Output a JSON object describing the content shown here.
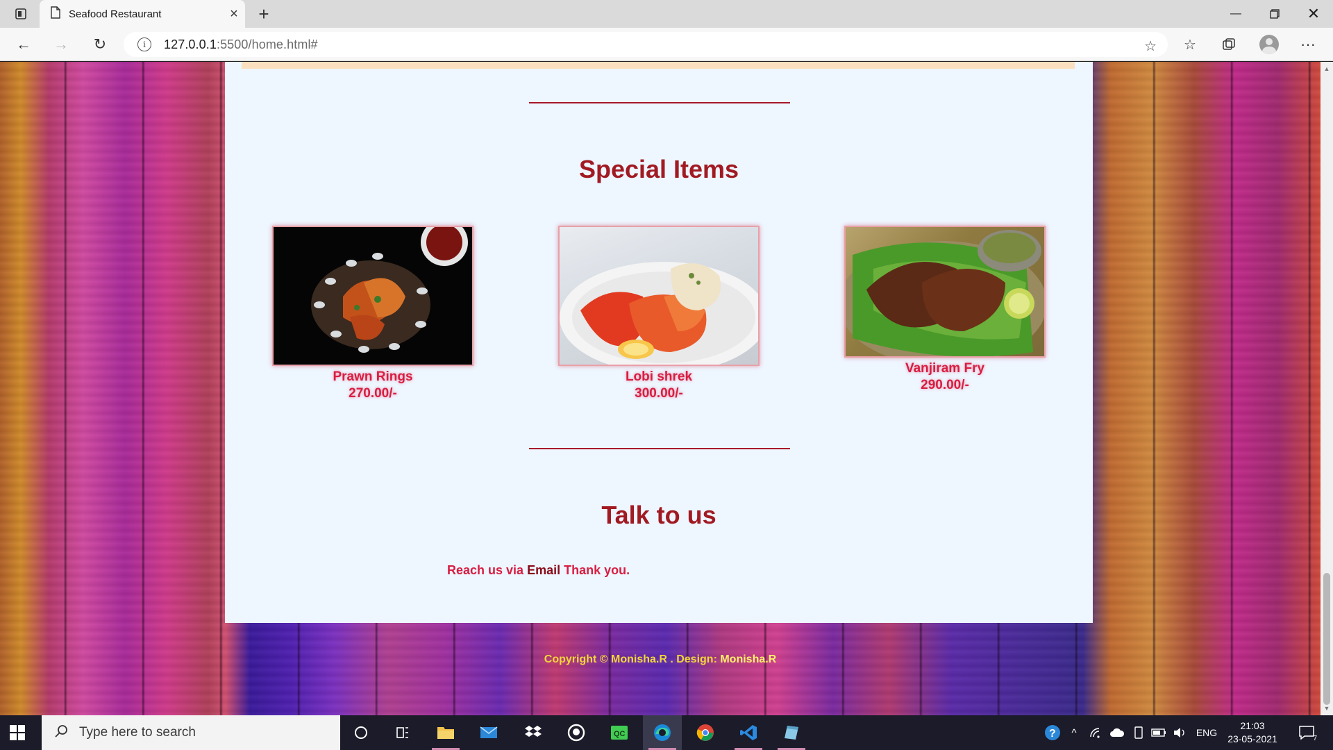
{
  "browser": {
    "tab_title": "Seafood Restaurant",
    "url_host": "127.0.0.1",
    "url_path": ":5500/home.html#"
  },
  "page": {
    "special_title": "Special Items",
    "items": [
      {
        "name": "Prawn Rings",
        "price": "270.00/-"
      },
      {
        "name": "Lobi shrek",
        "price": "300.00/-"
      },
      {
        "name": "Vanjiram Fry",
        "price": "290.00/-"
      }
    ],
    "contact_title": "Talk to us",
    "reach_prefix": "Reach us via",
    "reach_link": "Email",
    "reach_suffix": "Thank you.",
    "footer_prefix": "Copyright © Monisha.R . Design:",
    "footer_name": "Monisha.R"
  },
  "taskbar": {
    "search_placeholder": "Type here to search",
    "language": "ENG",
    "time": "21:03",
    "date": "23-05-2021",
    "notifications": "7"
  },
  "icons": {
    "tab_actions": "tab-actions-icon",
    "page": "page-icon",
    "back": "back-arrow-icon",
    "forward": "forward-arrow-icon",
    "refresh": "refresh-icon",
    "info": "info-icon",
    "favorites": "favorites-icon",
    "collections": "collections-icon",
    "menu": "more-icon"
  },
  "colors": {
    "heading": "#a11a22",
    "item_text": "#d81e42",
    "footer_text": "#f2d63a",
    "panel_bg": "#eef6ff"
  }
}
